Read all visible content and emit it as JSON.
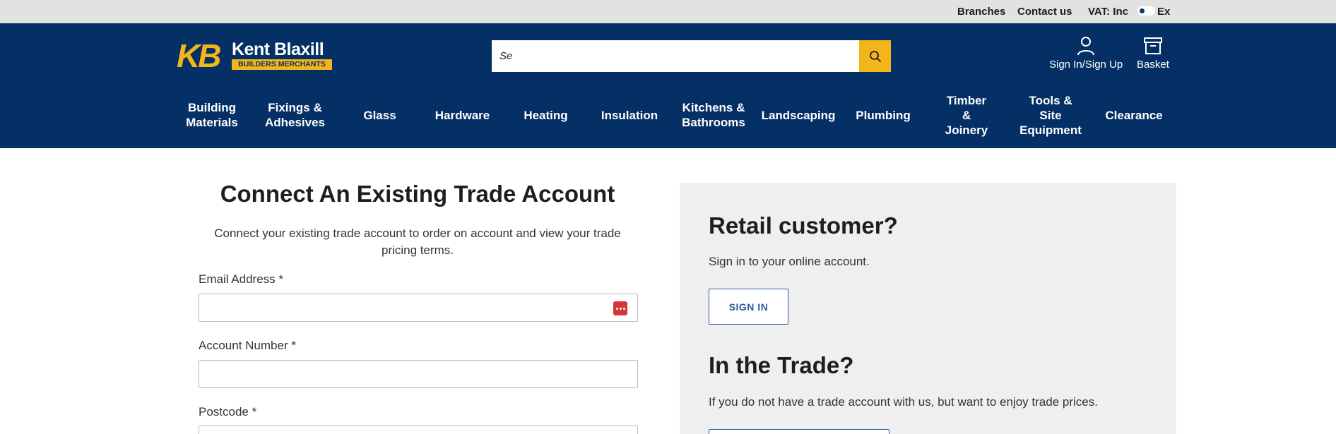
{
  "utility": {
    "branches": "Branches",
    "contact": "Contact us",
    "vat_label": "VAT: Inc",
    "vat_ex": "Ex"
  },
  "brand": {
    "mark": "KB",
    "name": "Kent Blaxill",
    "tagline": "BUILDERS MERCHANTS",
    "colors": {
      "navy": "#053065",
      "yellow": "#f2b61a"
    }
  },
  "search": {
    "value": "Se",
    "icon": "search-icon"
  },
  "header_actions": {
    "account": {
      "label": "Sign In/Sign Up",
      "icon": "user-icon"
    },
    "basket": {
      "label": "Basket",
      "icon": "basket-icon"
    }
  },
  "nav": [
    [
      "Building",
      "Materials"
    ],
    [
      "Fixings &",
      "Adhesives"
    ],
    [
      "Glass"
    ],
    [
      "Hardware"
    ],
    [
      "Heating"
    ],
    [
      "Insulation"
    ],
    [
      "Kitchens &",
      "Bathrooms"
    ],
    [
      "Landscaping"
    ],
    [
      "Plumbing"
    ],
    [
      "Timber",
      "&",
      "Joinery"
    ],
    [
      "Tools &",
      "Site",
      "Equipment"
    ],
    [
      "Clearance"
    ]
  ],
  "form": {
    "title": "Connect An Existing Trade Account",
    "description_line1": "Connect your existing trade account to order on account and view your trade",
    "description_line2": "pricing terms.",
    "email_label": "Email Address *",
    "account_label": "Account Number *",
    "postcode_label": "Postcode *",
    "email_value": "",
    "account_value": "",
    "postcode_value": ""
  },
  "panel": {
    "retail_heading": "Retail customer?",
    "retail_text": "Sign in to your online account.",
    "sign_in_button": "SIGN IN",
    "trade_heading": "In the Trade?",
    "trade_text": "If you do not have a trade account with us, but want to enjoy trade prices."
  }
}
